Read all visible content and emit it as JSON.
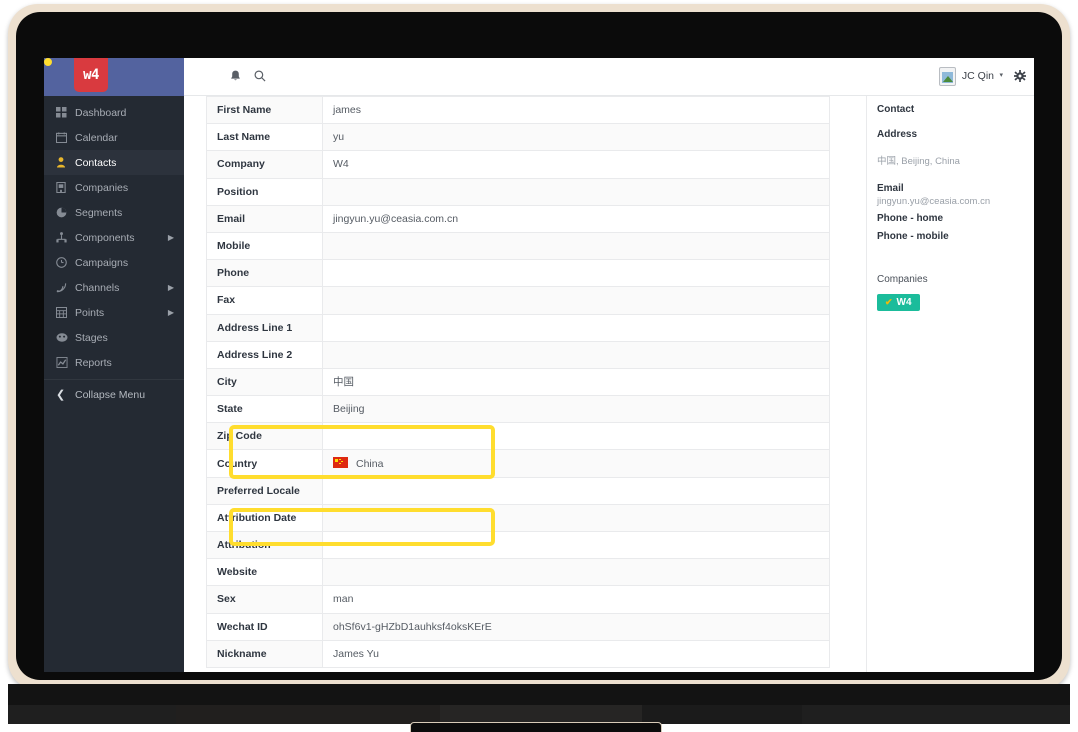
{
  "app": {
    "logo_text": "w4",
    "brand_red": "#d93a3f",
    "brand_blue": "#53639f",
    "sidebar_bg": "#242a33",
    "accent_yellow": "#ffdd2e",
    "badge_green": "#1bbc9b"
  },
  "sidebar": {
    "items": [
      {
        "label": "Dashboard",
        "icon": "grid-icon",
        "active": false,
        "caret": false
      },
      {
        "label": "Calendar",
        "icon": "calendar-icon",
        "active": false,
        "caret": false
      },
      {
        "label": "Contacts",
        "icon": "contact-icon",
        "active": true,
        "caret": false
      },
      {
        "label": "Companies",
        "icon": "building-icon",
        "active": false,
        "caret": false
      },
      {
        "label": "Segments",
        "icon": "pie-chart-icon",
        "active": false,
        "caret": false
      },
      {
        "label": "Components",
        "icon": "components-icon",
        "active": false,
        "caret": true
      },
      {
        "label": "Campaigns",
        "icon": "clock-icon",
        "active": false,
        "caret": false
      },
      {
        "label": "Channels",
        "icon": "rss-icon",
        "active": false,
        "caret": true
      },
      {
        "label": "Points",
        "icon": "points-icon",
        "active": false,
        "caret": true
      },
      {
        "label": "Stages",
        "icon": "stages-icon",
        "active": false,
        "caret": false
      },
      {
        "label": "Reports",
        "icon": "chart-line-icon",
        "active": false,
        "caret": false
      }
    ],
    "collapse_label": "Collapse Menu"
  },
  "topbar": {
    "bell_icon": "bell-icon",
    "search_icon": "search-icon",
    "user_name": "JC Qin",
    "caret": "▾",
    "gear_icon": "gear-icon",
    "avatar_icon": "broken-image-avatar-icon"
  },
  "detail_table": {
    "rows": [
      {
        "label": "First Name",
        "value": "james"
      },
      {
        "label": "Last Name",
        "value": "yu"
      },
      {
        "label": "Company",
        "value": "W4"
      },
      {
        "label": "Position",
        "value": ""
      },
      {
        "label": "Email",
        "value": "jingyun.yu@ceasia.com.cn"
      },
      {
        "label": "Mobile",
        "value": ""
      },
      {
        "label": "Phone",
        "value": ""
      },
      {
        "label": "Fax",
        "value": ""
      },
      {
        "label": "Address Line 1",
        "value": ""
      },
      {
        "label": "Address Line 2",
        "value": ""
      },
      {
        "label": "City",
        "value": "中国"
      },
      {
        "label": "State",
        "value": "Beijing"
      },
      {
        "label": "Zip Code",
        "value": ""
      },
      {
        "label": "Country",
        "value": "China",
        "flag": "cn"
      },
      {
        "label": "Preferred Locale",
        "value": ""
      },
      {
        "label": "Attribution Date",
        "value": ""
      },
      {
        "label": "Attribution",
        "value": ""
      },
      {
        "label": "Website",
        "value": ""
      },
      {
        "label": "Sex",
        "value": "man"
      },
      {
        "label": "Wechat ID",
        "value": "ohSf6v1-gHZbD1auhksf4oksKErE"
      },
      {
        "label": "Nickname",
        "value": "James Yu"
      }
    ]
  },
  "right_panel": {
    "contact_heading": "Contact",
    "address_heading": "Address",
    "address_value": "中国, Beijing, China",
    "email_label": "Email",
    "email_value": "jingyun.yu@ceasia.com.cn",
    "phone_home_label": "Phone - home",
    "phone_mobile_label": "Phone - mobile",
    "companies_label": "Companies",
    "company_badge": "W4",
    "company_check": "✔"
  },
  "annotations": {
    "boxes": [
      {
        "name": "highlight-city-state",
        "fields": [
          "City",
          "State"
        ]
      },
      {
        "name": "highlight-country",
        "fields": [
          "Country"
        ]
      },
      {
        "name": "highlight-sex-nickname",
        "fields": [
          "Sex",
          "Wechat ID",
          "Nickname"
        ]
      }
    ]
  }
}
